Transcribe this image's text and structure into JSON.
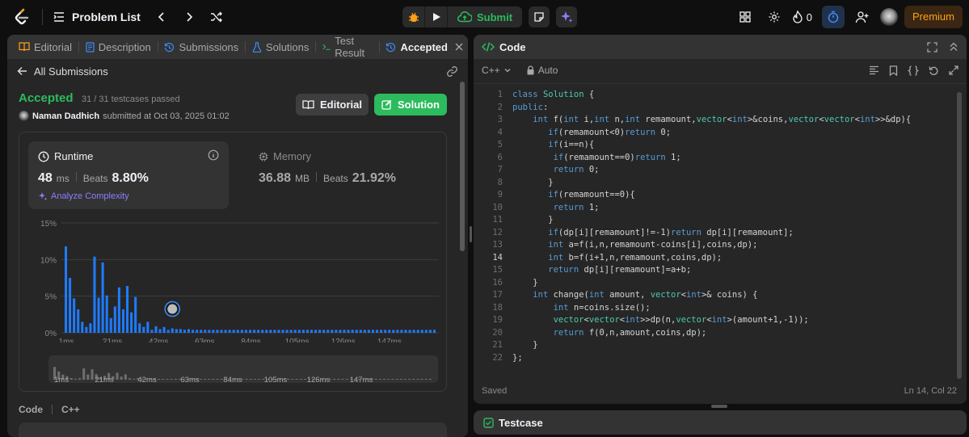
{
  "nav": {
    "problem_list": "Problem List",
    "submit": "Submit",
    "streak": "0",
    "premium": "Premium"
  },
  "left_tabs": [
    {
      "label": "Editorial",
      "icon": "book-icon"
    },
    {
      "label": "Description",
      "icon": "doc-icon"
    },
    {
      "label": "Submissions",
      "icon": "history-icon"
    },
    {
      "label": "Solutions",
      "icon": "flask-icon"
    },
    {
      "label": "Test Result",
      "icon": "terminal-icon"
    },
    {
      "label": "Accepted",
      "icon": "history-icon"
    }
  ],
  "sub": {
    "all_submissions": "All Submissions"
  },
  "result": {
    "status": "Accepted",
    "testcases": "31 / 31 testcases passed",
    "user": "Naman Dadhich",
    "submitted": "submitted at Oct 03, 2025 01:02",
    "editorial_btn": "Editorial",
    "solution_btn": "Solution"
  },
  "runtime": {
    "label": "Runtime",
    "value": "48",
    "unit": "ms",
    "beats_label": "Beats",
    "beats": "8.80%",
    "analyze": "Analyze Complexity"
  },
  "memory": {
    "label": "Memory",
    "value": "36.88",
    "unit": "MB",
    "beats_label": "Beats",
    "beats": "21.92%"
  },
  "code_section": {
    "label": "Code",
    "lang": "C++"
  },
  "chart_data": {
    "type": "bar",
    "y_ticks": [
      "15%",
      "10%",
      "5%",
      "0%"
    ],
    "ylim": [
      0,
      15
    ],
    "x_ticks": [
      "1ms",
      "21ms",
      "42ms",
      "63ms",
      "84ms",
      "105ms",
      "126ms",
      "147ms"
    ],
    "values": [
      11.8,
      7.5,
      4.7,
      3.2,
      1.5,
      0.8,
      1.3,
      10.4,
      4.8,
      9.6,
      5.1,
      2.0,
      3.6,
      6.2,
      3.2,
      6.4,
      2.8,
      4.9,
      1.3,
      0.8,
      1.5,
      0.4,
      0.9,
      0.5,
      0.8,
      0.4,
      0.6,
      0.5,
      0.5,
      0.4,
      0.5,
      0.4,
      0.4,
      0.4,
      0.4,
      0.4,
      0.4,
      0.4,
      0.4,
      0.4,
      0.4,
      0.4,
      0.4,
      0.4,
      0.4,
      0.4,
      0.4,
      0.4,
      0.4,
      0.4,
      0.4,
      0.4,
      0.4,
      0.4,
      0.4,
      0.4,
      0.4,
      0.4,
      0.4,
      0.4,
      0.4,
      0.4,
      0.4,
      0.4,
      0.4,
      0.4,
      0.4,
      0.4,
      0.4,
      0.4,
      0.4,
      0.4,
      0.4,
      0.4,
      0.4,
      0.4,
      0.4,
      0.4,
      0.4,
      0.4,
      0.4,
      0.4,
      0.4,
      0.4,
      0.4,
      0.4,
      0.4,
      0.4,
      0.4,
      0.4,
      0.4
    ],
    "highlight_index": 26,
    "bar_color": "#1e7bff",
    "grid": true
  },
  "editor": {
    "title": "Code",
    "lang": "C++",
    "mode": "Auto",
    "status": "Saved",
    "cursor": "Ln 14, Col 22",
    "current_line": 14,
    "lines": [
      "class Solution {",
      "public:",
      "    int f(int i,int n,int remamount,vector<int>&coins,vector<vector<int>>&dp){",
      "       if(remamount<0)return 0;",
      "       if(i==n){",
      "        if(remamount==0)return 1;",
      "        return 0;",
      "       }",
      "       if(remamount==0){",
      "        return 1;",
      "       }",
      "       if(dp[i][remamount]!=-1)return dp[i][remamount];",
      "       int a=f(i,n,remamount-coins[i],coins,dp);",
      "       int b=f(i+1,n,remamount,coins,dp);",
      "       return dp[i][remamount]=a+b;",
      "    }",
      "    int change(int amount, vector<int>& coins) {",
      "        int n=coins.size();",
      "        vector<vector<int>>dp(n,vector<int>(amount+1,-1));",
      "        return f(0,n,amount,coins,dp);",
      "    }",
      "};"
    ]
  },
  "testcase": {
    "label": "Testcase"
  }
}
